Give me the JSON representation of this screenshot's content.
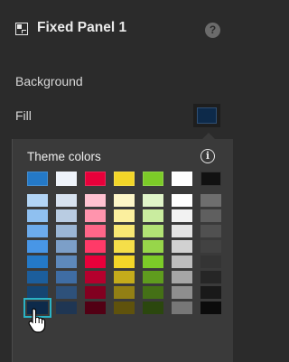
{
  "header": {
    "title": "Fixed Panel 1",
    "icon": "panel-layout-icon",
    "help_icon": "help-icon",
    "help_glyph": "?"
  },
  "background": {
    "label": "Background",
    "fill_label": "Fill",
    "fill_color": "#0d2a4a"
  },
  "picker": {
    "title": "Theme colors",
    "info_icon": "info-icon",
    "info_glyph": "i",
    "theme_colors": [
      "#2479c7",
      "#eef3fa",
      "#e8003a",
      "#f3d628",
      "#7ccb28",
      "#ffffff",
      "#111111"
    ],
    "shade_columns": [
      [
        "#b2d4f5",
        "#8fc0f0",
        "#6cabec",
        "#4896e6",
        "#2479c7",
        "#1c5e9c",
        "#154572",
        "#0d2a4a"
      ],
      [
        "#d7e2ef",
        "#b9cce2",
        "#9bb6d5",
        "#7c9fc8",
        "#5e89bb",
        "#3f6da4",
        "#2e517a",
        "#1f3653"
      ],
      [
        "#ffc2d1",
        "#ff94ad",
        "#ff6688",
        "#ff3a68",
        "#e8003a",
        "#b5002d",
        "#820020",
        "#520014"
      ],
      [
        "#fdf6c8",
        "#fbef9e",
        "#f8e773",
        "#f5de49",
        "#f3d628",
        "#c4ab1b",
        "#927f14",
        "#5f520c"
      ],
      [
        "#e0f4c9",
        "#c9ec9f",
        "#b2e375",
        "#97d64a",
        "#7ccb28",
        "#5f9c1e",
        "#447016",
        "#2b470e"
      ],
      [
        "#ffffff",
        "#f2f2f2",
        "#e3e3e3",
        "#d1d1d1",
        "#bdbdbd",
        "#a6a6a6",
        "#8e8e8e",
        "#777777"
      ],
      [
        "#6e6e6e",
        "#5f5f5f",
        "#505050",
        "#424242",
        "#343434",
        "#262626",
        "#191919",
        "#0b0b0b"
      ]
    ],
    "selected": {
      "column": 0,
      "row": 7
    }
  },
  "cursor": {
    "icon": "hand-pointer-icon"
  }
}
